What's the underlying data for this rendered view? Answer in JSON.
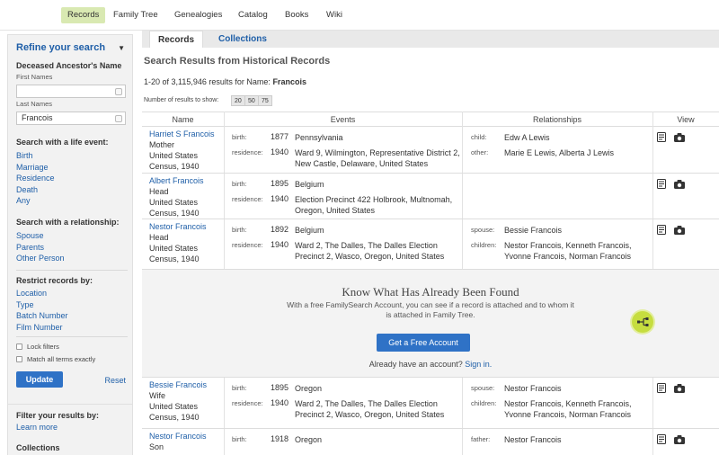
{
  "topnav": {
    "items": [
      "Records",
      "Family Tree",
      "Genealogies",
      "Catalog",
      "Books",
      "Wiki"
    ],
    "active": "Records"
  },
  "sidebar": {
    "title": "Refine your search",
    "ancestor_heading": "Deceased Ancestor's Name",
    "first_names_label": "First Names",
    "first_names_value": "",
    "last_names_label": "Last Names",
    "last_names_value": "Francois",
    "life_event_heading": "Search with a life event:",
    "life_events": [
      "Birth",
      "Marriage",
      "Residence",
      "Death",
      "Any"
    ],
    "relationship_heading": "Search with a relationship:",
    "relationships": [
      "Spouse",
      "Parents",
      "Other Person"
    ],
    "restrict_heading": "Restrict records by:",
    "restrict": [
      "Location",
      "Type",
      "Batch Number",
      "Film Number"
    ],
    "lock_filters": "Lock filters",
    "match_all": "Match all terms exactly",
    "update": "Update",
    "reset": "Reset",
    "filter_heading": "Filter your results by:",
    "learn_more": "Learn more",
    "collections": "Collections"
  },
  "tabs": [
    "Records",
    "Collections"
  ],
  "results": {
    "heading": "Search Results from Historical Records",
    "count_prefix": "1-20 of 3,115,946 results for Name:",
    "count_name": "Francois",
    "shown_label": "Number of results to show:",
    "shown_options": [
      "20",
      "50",
      "75"
    ]
  },
  "table": {
    "headers": [
      "Name",
      "Events",
      "Relationships",
      "View"
    ],
    "rows": [
      {
        "name": "Harriet S Francois",
        "role": "Mother",
        "place": "United States",
        "census": "Census, 1940",
        "events": [
          {
            "label": "birth:",
            "year": "1877",
            "text": "Pennsylvania"
          },
          {
            "label": "residence:",
            "year": "1940",
            "text": "Ward 9, Wilmington, Representative District 2, New Castle, Delaware, United States"
          }
        ],
        "rels": [
          {
            "label": "child:",
            "text": "Edw A Lewis"
          },
          {
            "label": "other:",
            "text": "Marie E Lewis, Alberta J Lewis"
          }
        ]
      },
      {
        "name": "Albert Francois",
        "role": "Head",
        "place": "United States",
        "census": "Census, 1940",
        "events": [
          {
            "label": "birth:",
            "year": "1895",
            "text": "Belgium"
          },
          {
            "label": "residence:",
            "year": "1940",
            "text": "Election Precinct 422 Holbrook, Multnomah, Oregon, United States"
          }
        ],
        "rels": []
      },
      {
        "name": "Nestor Francois",
        "role": "Head",
        "place": "United States",
        "census": "Census, 1940",
        "events": [
          {
            "label": "birth:",
            "year": "1892",
            "text": "Belgium"
          },
          {
            "label": "residence:",
            "year": "1940",
            "text": "Ward 2, The Dalles, The Dalles Election Precinct 2, Wasco, Oregon, United States"
          }
        ],
        "rels": [
          {
            "label": "spouse:",
            "text": "Bessie Francois"
          },
          {
            "label": "children:",
            "text": "Nestor Francois, Kenneth Francois, Yvonne Francois, Norman Francois"
          }
        ]
      },
      {
        "name": "Bessie Francois",
        "role": "Wife",
        "place": "United States",
        "census": "Census, 1940",
        "events": [
          {
            "label": "birth:",
            "year": "1895",
            "text": "Oregon"
          },
          {
            "label": "residence:",
            "year": "1940",
            "text": "Ward 2, The Dalles, The Dalles Election Precinct 2, Wasco, Oregon, United States"
          }
        ],
        "rels": [
          {
            "label": "spouse:",
            "text": "Nestor Francois"
          },
          {
            "label": "children:",
            "text": "Nestor Francois, Kenneth Francois, Yvonne Francois, Norman Francois"
          }
        ]
      },
      {
        "name": "Nestor Francois",
        "role": "Son",
        "place": "",
        "census": "",
        "events": [
          {
            "label": "birth:",
            "year": "1918",
            "text": "Oregon"
          }
        ],
        "rels": [
          {
            "label": "father:",
            "text": "Nestor Francois"
          }
        ]
      }
    ]
  },
  "promo": {
    "title": "Know What Has Already Been Found",
    "text": "With a free FamilySearch Account, you can see if a record is attached and to whom it is attached in Family Tree.",
    "button": "Get a Free Account",
    "signin_prefix": "Already have an account?",
    "signin_link": "Sign in."
  },
  "colors": {
    "link": "#1f5fa8",
    "button": "#2f72c6",
    "active_nav": "#d9e9b2",
    "tree_badge": "#c6dd3f"
  }
}
